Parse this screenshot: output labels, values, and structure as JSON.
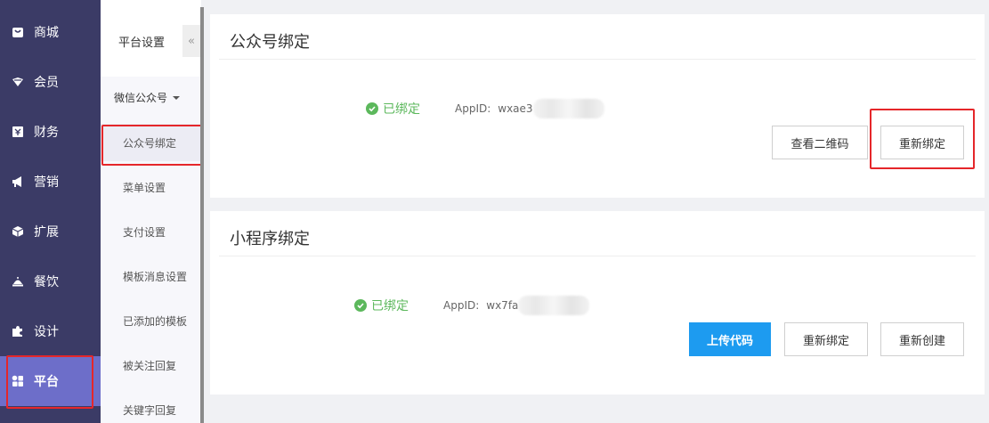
{
  "nav": {
    "items": [
      {
        "label": "商城",
        "icon": "store-icon"
      },
      {
        "label": "会员",
        "icon": "member-icon"
      },
      {
        "label": "财务",
        "icon": "finance-icon"
      },
      {
        "label": "营销",
        "icon": "megaphone-icon"
      },
      {
        "label": "扩展",
        "icon": "box-icon"
      },
      {
        "label": "餐饮",
        "icon": "food-cover-icon"
      },
      {
        "label": "设计",
        "icon": "puzzle-icon"
      },
      {
        "label": "平台",
        "icon": "grid-icon"
      }
    ],
    "active": "平台"
  },
  "subnav": {
    "title": "平台设置",
    "collapse": "«",
    "group": "微信公众号",
    "items": [
      {
        "label": "公众号绑定"
      },
      {
        "label": "菜单设置"
      },
      {
        "label": "支付设置"
      },
      {
        "label": "模板消息设置"
      },
      {
        "label": "已添加的模板"
      },
      {
        "label": "被关注回复"
      },
      {
        "label": "关键字回复"
      }
    ],
    "active": "公众号绑定"
  },
  "official_account": {
    "title": "公众号绑定",
    "status": "已绑定",
    "appid_label": "AppID:",
    "appid_value": "wxae3",
    "buttons": {
      "qrcode": "查看二维码",
      "rebind": "重新绑定"
    }
  },
  "mini_program": {
    "title": "小程序绑定",
    "status": "已绑定",
    "appid_label": "AppID:",
    "appid_value": "wx7fa",
    "buttons": {
      "upload": "上传代码",
      "rebind": "重新绑定",
      "recreate": "重新创建"
    }
  },
  "colors": {
    "nav_bg": "#3b3b66",
    "nav_active": "#6d6ec9",
    "success": "#5cb85c",
    "primary": "#1d9bf0",
    "highlight": "#e5262a"
  }
}
